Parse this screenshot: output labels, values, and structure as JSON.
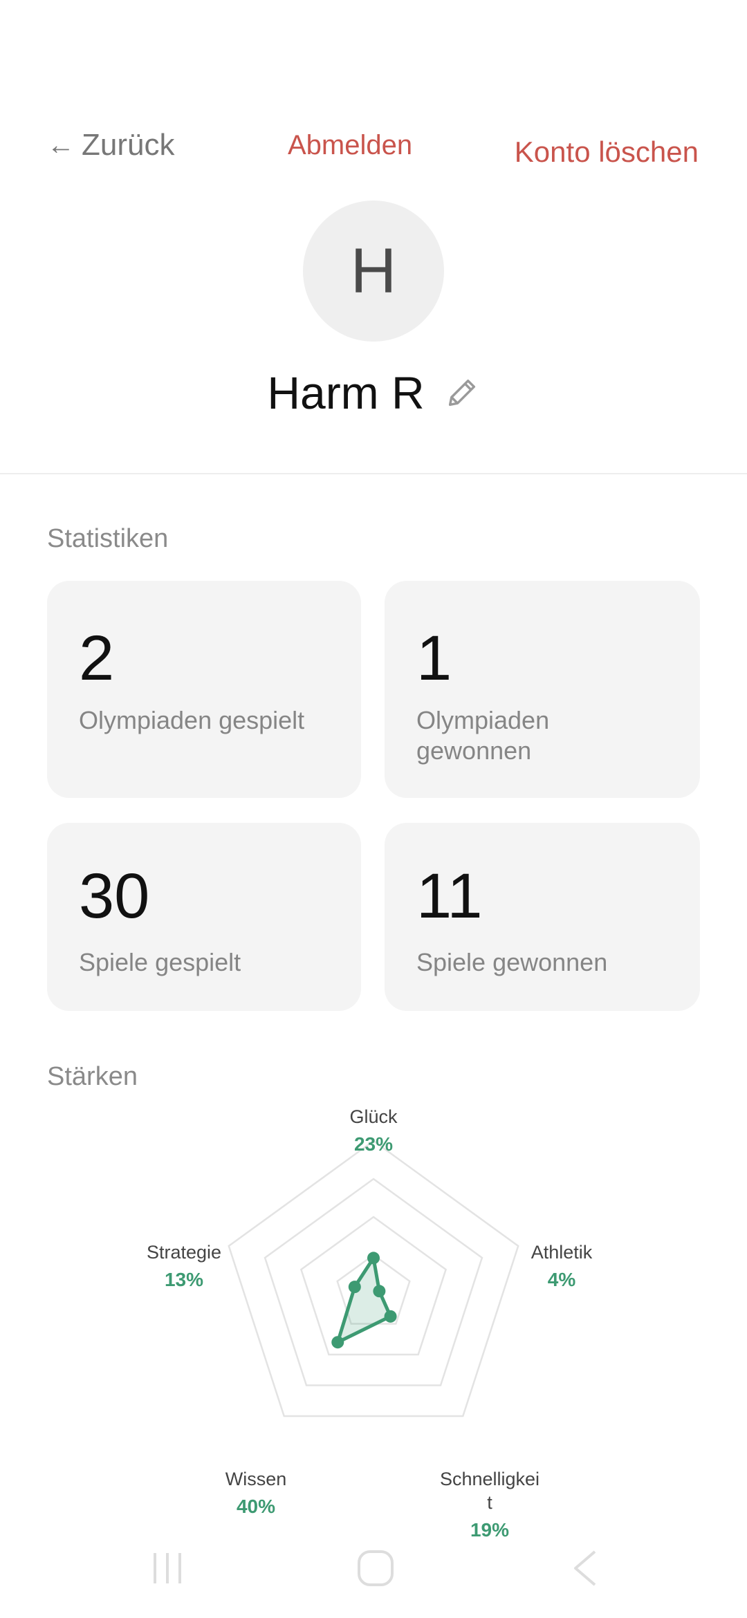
{
  "header": {
    "back_label": "Zurück",
    "logout_label": "Abmelden",
    "delete_label": "Konto löschen"
  },
  "profile": {
    "initial": "H",
    "name": "Harm R"
  },
  "stats": {
    "title": "Statistiken",
    "cards": [
      {
        "value": "2",
        "label": "Olympiaden gespielt"
      },
      {
        "value": "1",
        "label": "Olympiaden gewonnen"
      },
      {
        "value": "30",
        "label": "Spiele gespielt"
      },
      {
        "value": "11",
        "label": "Spiele gewonnen"
      }
    ]
  },
  "strengths": {
    "title": "Stärken"
  },
  "chart_data": {
    "type": "radar",
    "axes": [
      "Glück",
      "Athletik",
      "Schnelligkeit",
      "Wissen",
      "Strategie"
    ],
    "axis_labels_display": [
      "Glück",
      "Athletik",
      "Schnelligkei\nt",
      "Wissen",
      "Strategie"
    ],
    "values": [
      23,
      4,
      19,
      40,
      13
    ],
    "value_labels": [
      "23%",
      "4%",
      "19%",
      "40%",
      "13%"
    ],
    "max": 100,
    "grid_levels": 4,
    "color": "#3d9a72"
  },
  "colors": {
    "accent_red": "#c9544c",
    "accent_green": "#3d9a72",
    "card_bg": "#f4f4f4"
  },
  "system_nav": [
    "recent-apps-icon",
    "home-icon",
    "back-icon"
  ]
}
